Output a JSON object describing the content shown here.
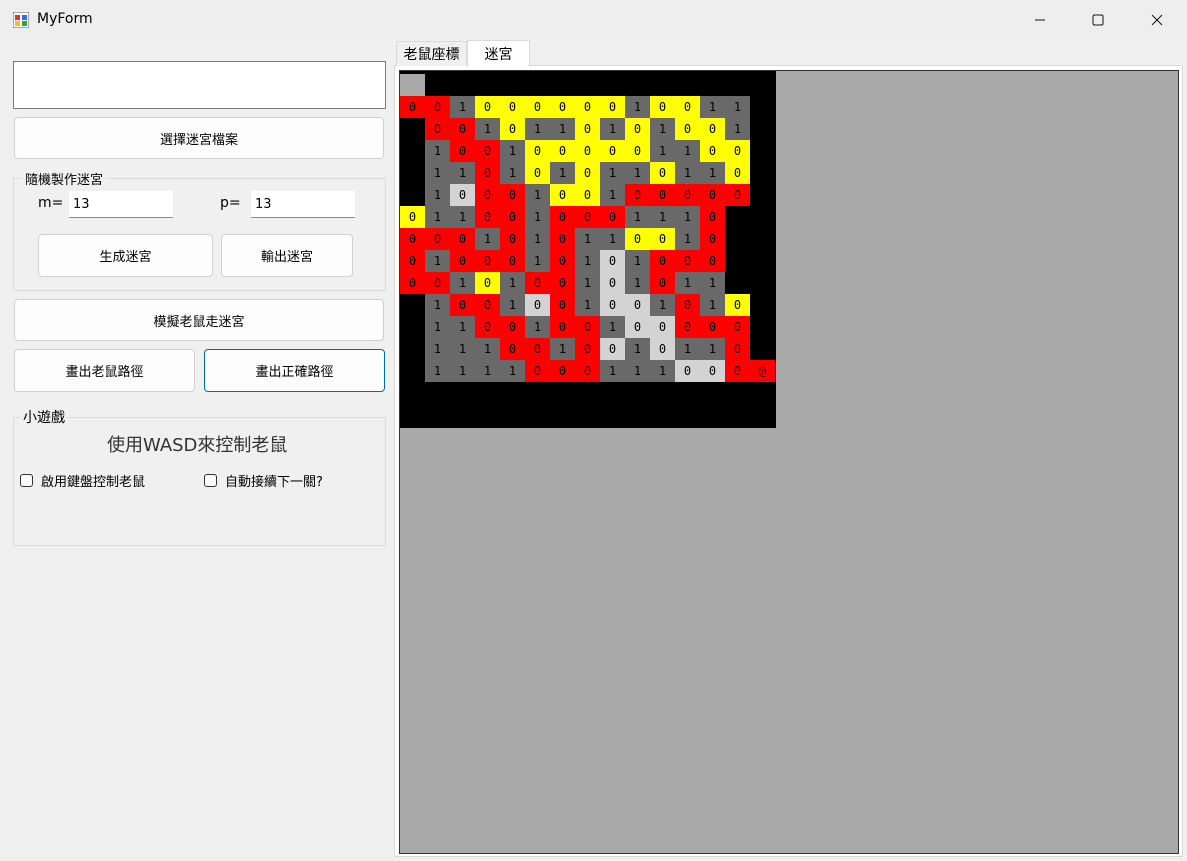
{
  "window": {
    "title": "MyForm",
    "icons": {
      "app": "app-icon",
      "minimize": "minimize-icon",
      "maximize": "maximize-icon",
      "close": "close-icon"
    }
  },
  "left_panel": {
    "select_file_button": "選擇迷宮檔案",
    "random_group": {
      "title": "隨機製作迷宮",
      "m_label": "m=",
      "m_value": "13",
      "p_label": "p=",
      "p_value": "13",
      "generate_button": "生成迷宮",
      "export_button": "輸出迷宮"
    },
    "simulate_button": "模擬老鼠走迷宮",
    "draw_mouse_path_button": "畫出老鼠路徑",
    "draw_correct_path_button": "畫出正確路徑",
    "game_group": {
      "title": "小遊戲",
      "instruction": "使用WASD來控制老鼠",
      "enable_keyboard_label": "啟用鍵盤控制老鼠",
      "auto_next_label": "自動接續下一關?"
    }
  },
  "tabs": [
    {
      "label": "老鼠座標",
      "active": false
    },
    {
      "label": "迷宮",
      "active": true
    }
  ],
  "maze": {
    "colors": {
      "wall": "#000000",
      "red": "#ff0000",
      "yellow": "#ffff00",
      "gray": "#696969",
      "light": "#d3d3d3",
      "background": "#a9a9a9"
    },
    "color_codes": {
      "K": "wall",
      "R": "red",
      "Y": "yellow",
      "G": "gray",
      "L": "light",
      "A": "background"
    },
    "rows": [
      {
        "colors": "AKKKKKKKKKKKKKK",
        "values": [
          "",
          "",
          "",
          "",
          "",
          "",
          "",
          "",
          "",
          "",
          "",
          "",
          "",
          "",
          ""
        ]
      },
      {
        "colors": "RRGYYYYYYGYYGGK",
        "values": [
          "0",
          "0",
          "1",
          "0",
          "0",
          "0",
          "0",
          "0",
          "0",
          "1",
          "0",
          "0",
          "1",
          "1",
          ""
        ]
      },
      {
        "colors": "KRRGYGGYGYGYYGK",
        "values": [
          "",
          "0",
          "0",
          "1",
          "0",
          "1",
          "1",
          "0",
          "1",
          "0",
          "1",
          "0",
          "0",
          "1",
          ""
        ]
      },
      {
        "colors": "KGRRGYYYYYGGYYK",
        "values": [
          "",
          "1",
          "0",
          "0",
          "1",
          "0",
          "0",
          "0",
          "0",
          "0",
          "1",
          "1",
          "0",
          "0",
          ""
        ]
      },
      {
        "colors": "KGGRGYGYGGYGGYK",
        "values": [
          "",
          "1",
          "1",
          "0",
          "1",
          "0",
          "1",
          "0",
          "1",
          "1",
          "0",
          "1",
          "1",
          "0",
          ""
        ]
      },
      {
        "colors": "KGLRRGYYGRRRRRK",
        "values": [
          "",
          "1",
          "0",
          "0",
          "0",
          "1",
          "0",
          "0",
          "1",
          "0",
          "0",
          "0",
          "0",
          "0",
          ""
        ]
      },
      {
        "colors": "YGGRRGRRRGGGRK",
        "values": [
          "0",
          "1",
          "1",
          "0",
          "0",
          "1",
          "0",
          "0",
          "0",
          "1",
          "1",
          "1",
          "0",
          ""
        ]
      },
      {
        "colors": "RRRGRGRGGYYGRK",
        "values": [
          "0",
          "0",
          "0",
          "1",
          "0",
          "1",
          "0",
          "1",
          "1",
          "0",
          "0",
          "1",
          "0",
          ""
        ]
      },
      {
        "colors": "RGRRRGRGLGRRRK",
        "values": [
          "0",
          "1",
          "0",
          "0",
          "0",
          "1",
          "0",
          "1",
          "0",
          "1",
          "0",
          "0",
          "0",
          ""
        ]
      },
      {
        "colors": "RRGYGRRGLGRGGK",
        "values": [
          "0",
          "0",
          "1",
          "0",
          "1",
          "0",
          "0",
          "1",
          "0",
          "1",
          "0",
          "1",
          "1",
          ""
        ]
      },
      {
        "colors": "KGRRGLRGLLGRGYK",
        "values": [
          "",
          "1",
          "0",
          "0",
          "1",
          "0",
          "0",
          "1",
          "0",
          "0",
          "1",
          "0",
          "1",
          "0",
          ""
        ]
      },
      {
        "colors": "KGGRRGRRGLLRRRK",
        "values": [
          "",
          "1",
          "1",
          "0",
          "0",
          "1",
          "0",
          "0",
          "1",
          "0",
          "0",
          "0",
          "0",
          "0",
          ""
        ]
      },
      {
        "colors": "KGGGRRGRLGLGGRK",
        "values": [
          "",
          "1",
          "1",
          "1",
          "0",
          "0",
          "1",
          "0",
          "0",
          "1",
          "0",
          "1",
          "1",
          "0",
          ""
        ]
      },
      {
        "colors": "KGGGGRRRGGGLLRR",
        "values": [
          "",
          "1",
          "1",
          "1",
          "1",
          "0",
          "0",
          "0",
          "1",
          "1",
          "1",
          "0",
          "0",
          "0",
          "@"
        ]
      },
      {
        "colors": "KKKKKKKKKKKKKKK",
        "values": [
          "",
          "",
          "",
          "",
          "",
          "",
          "",
          "",
          "",
          "",
          "",
          "",
          "",
          "",
          ""
        ]
      }
    ]
  }
}
